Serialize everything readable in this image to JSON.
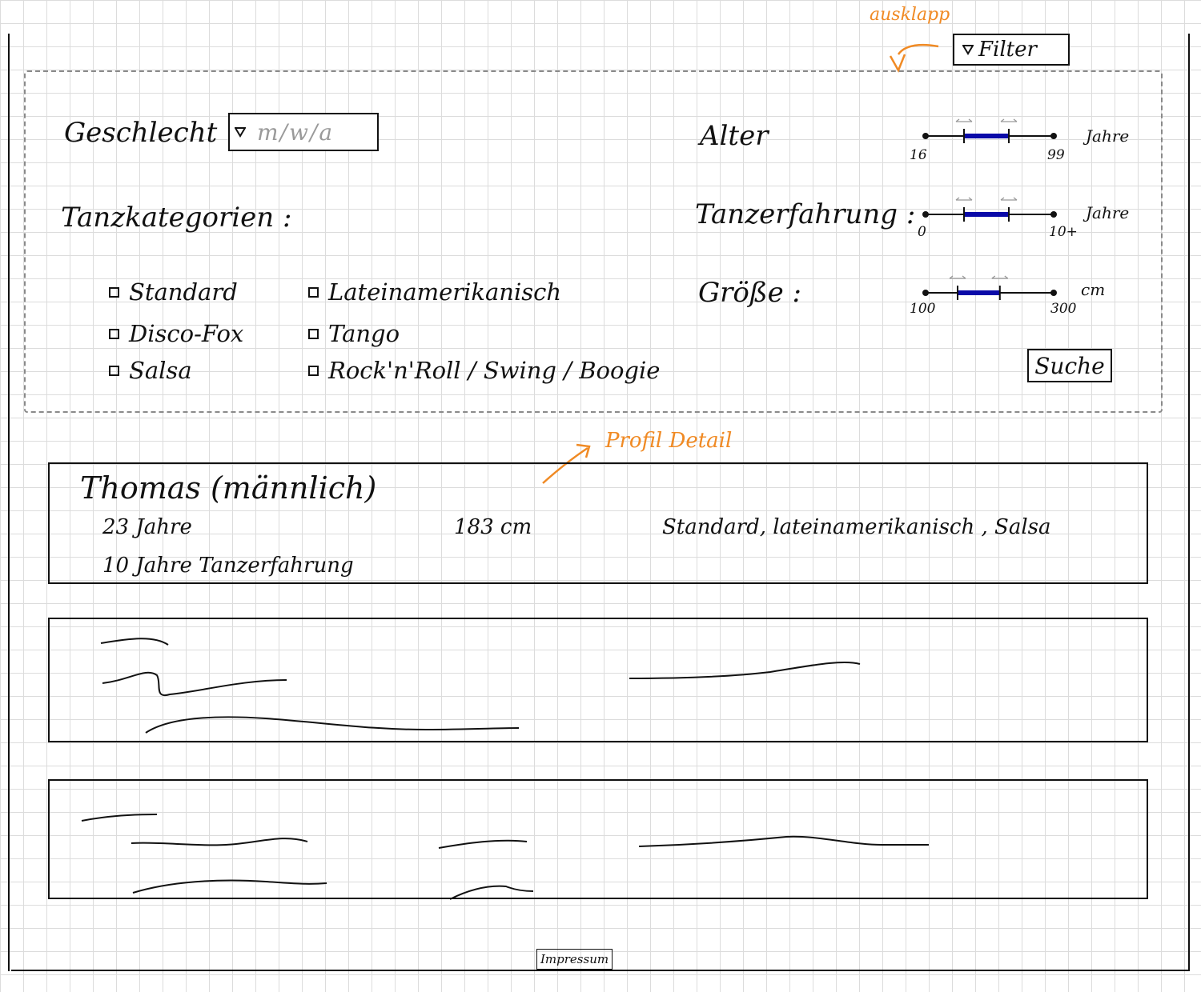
{
  "annotations": {
    "expand_note": "ausklapp",
    "detail_note": "Profil Detail"
  },
  "filter_toggle": {
    "label": "Filter",
    "icon": "triangle-down-icon"
  },
  "filter": {
    "gender": {
      "label": "Geschlecht",
      "value": "m/w/a"
    },
    "dance_categories": {
      "label": "Tanzkategorien :",
      "items": [
        "Standard",
        "Disco-Fox",
        "Salsa",
        "Lateinamerikanisch",
        "Tango",
        "Rock'n'Roll / Swing / Boogie"
      ]
    },
    "age": {
      "label": "Alter",
      "min": "16",
      "max": "99",
      "unit": "Jahre",
      "range_start": 0.3,
      "range_end": 0.65
    },
    "experience": {
      "label": "Tanzerfahrung :",
      "min": "0",
      "max": "10+",
      "unit": "Jahre",
      "range_start": 0.3,
      "range_end": 0.65
    },
    "height": {
      "label": "Größe :",
      "min": "100",
      "max": "300",
      "unit": "cm",
      "range_start": 0.25,
      "range_end": 0.58
    },
    "search_label": "Suche"
  },
  "results": [
    {
      "name": "Thomas (männlich)",
      "age": "23 Jahre",
      "height": "183 cm",
      "categories": "Standard, lateinamerikanisch , Salsa",
      "experience": "10 Jahre Tanzerfahrung"
    }
  ],
  "footer": {
    "imprint": "Impressum"
  }
}
